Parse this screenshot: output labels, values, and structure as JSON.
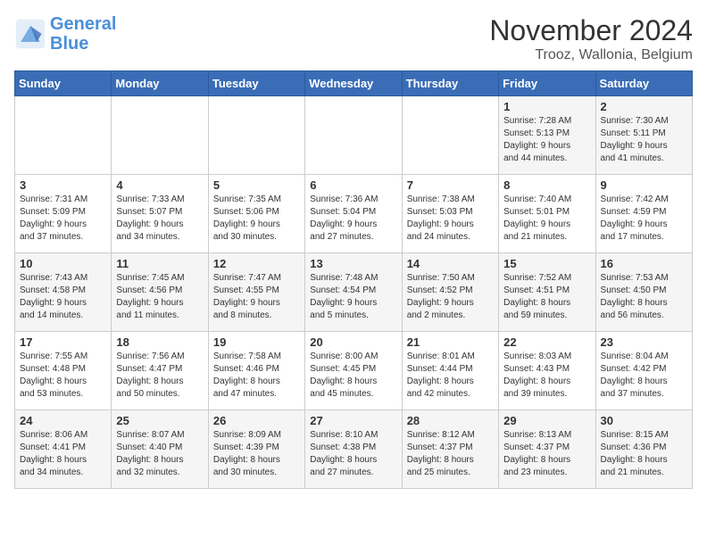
{
  "header": {
    "logo_line1": "General",
    "logo_line2": "Blue",
    "month": "November 2024",
    "location": "Trooz, Wallonia, Belgium"
  },
  "weekdays": [
    "Sunday",
    "Monday",
    "Tuesday",
    "Wednesday",
    "Thursday",
    "Friday",
    "Saturday"
  ],
  "weeks": [
    [
      {
        "day": "",
        "info": ""
      },
      {
        "day": "",
        "info": ""
      },
      {
        "day": "",
        "info": ""
      },
      {
        "day": "",
        "info": ""
      },
      {
        "day": "",
        "info": ""
      },
      {
        "day": "1",
        "info": "Sunrise: 7:28 AM\nSunset: 5:13 PM\nDaylight: 9 hours\nand 44 minutes."
      },
      {
        "day": "2",
        "info": "Sunrise: 7:30 AM\nSunset: 5:11 PM\nDaylight: 9 hours\nand 41 minutes."
      }
    ],
    [
      {
        "day": "3",
        "info": "Sunrise: 7:31 AM\nSunset: 5:09 PM\nDaylight: 9 hours\nand 37 minutes."
      },
      {
        "day": "4",
        "info": "Sunrise: 7:33 AM\nSunset: 5:07 PM\nDaylight: 9 hours\nand 34 minutes."
      },
      {
        "day": "5",
        "info": "Sunrise: 7:35 AM\nSunset: 5:06 PM\nDaylight: 9 hours\nand 30 minutes."
      },
      {
        "day": "6",
        "info": "Sunrise: 7:36 AM\nSunset: 5:04 PM\nDaylight: 9 hours\nand 27 minutes."
      },
      {
        "day": "7",
        "info": "Sunrise: 7:38 AM\nSunset: 5:03 PM\nDaylight: 9 hours\nand 24 minutes."
      },
      {
        "day": "8",
        "info": "Sunrise: 7:40 AM\nSunset: 5:01 PM\nDaylight: 9 hours\nand 21 minutes."
      },
      {
        "day": "9",
        "info": "Sunrise: 7:42 AM\nSunset: 4:59 PM\nDaylight: 9 hours\nand 17 minutes."
      }
    ],
    [
      {
        "day": "10",
        "info": "Sunrise: 7:43 AM\nSunset: 4:58 PM\nDaylight: 9 hours\nand 14 minutes."
      },
      {
        "day": "11",
        "info": "Sunrise: 7:45 AM\nSunset: 4:56 PM\nDaylight: 9 hours\nand 11 minutes."
      },
      {
        "day": "12",
        "info": "Sunrise: 7:47 AM\nSunset: 4:55 PM\nDaylight: 9 hours\nand 8 minutes."
      },
      {
        "day": "13",
        "info": "Sunrise: 7:48 AM\nSunset: 4:54 PM\nDaylight: 9 hours\nand 5 minutes."
      },
      {
        "day": "14",
        "info": "Sunrise: 7:50 AM\nSunset: 4:52 PM\nDaylight: 9 hours\nand 2 minutes."
      },
      {
        "day": "15",
        "info": "Sunrise: 7:52 AM\nSunset: 4:51 PM\nDaylight: 8 hours\nand 59 minutes."
      },
      {
        "day": "16",
        "info": "Sunrise: 7:53 AM\nSunset: 4:50 PM\nDaylight: 8 hours\nand 56 minutes."
      }
    ],
    [
      {
        "day": "17",
        "info": "Sunrise: 7:55 AM\nSunset: 4:48 PM\nDaylight: 8 hours\nand 53 minutes."
      },
      {
        "day": "18",
        "info": "Sunrise: 7:56 AM\nSunset: 4:47 PM\nDaylight: 8 hours\nand 50 minutes."
      },
      {
        "day": "19",
        "info": "Sunrise: 7:58 AM\nSunset: 4:46 PM\nDaylight: 8 hours\nand 47 minutes."
      },
      {
        "day": "20",
        "info": "Sunrise: 8:00 AM\nSunset: 4:45 PM\nDaylight: 8 hours\nand 45 minutes."
      },
      {
        "day": "21",
        "info": "Sunrise: 8:01 AM\nSunset: 4:44 PM\nDaylight: 8 hours\nand 42 minutes."
      },
      {
        "day": "22",
        "info": "Sunrise: 8:03 AM\nSunset: 4:43 PM\nDaylight: 8 hours\nand 39 minutes."
      },
      {
        "day": "23",
        "info": "Sunrise: 8:04 AM\nSunset: 4:42 PM\nDaylight: 8 hours\nand 37 minutes."
      }
    ],
    [
      {
        "day": "24",
        "info": "Sunrise: 8:06 AM\nSunset: 4:41 PM\nDaylight: 8 hours\nand 34 minutes."
      },
      {
        "day": "25",
        "info": "Sunrise: 8:07 AM\nSunset: 4:40 PM\nDaylight: 8 hours\nand 32 minutes."
      },
      {
        "day": "26",
        "info": "Sunrise: 8:09 AM\nSunset: 4:39 PM\nDaylight: 8 hours\nand 30 minutes."
      },
      {
        "day": "27",
        "info": "Sunrise: 8:10 AM\nSunset: 4:38 PM\nDaylight: 8 hours\nand 27 minutes."
      },
      {
        "day": "28",
        "info": "Sunrise: 8:12 AM\nSunset: 4:37 PM\nDaylight: 8 hours\nand 25 minutes."
      },
      {
        "day": "29",
        "info": "Sunrise: 8:13 AM\nSunset: 4:37 PM\nDaylight: 8 hours\nand 23 minutes."
      },
      {
        "day": "30",
        "info": "Sunrise: 8:15 AM\nSunset: 4:36 PM\nDaylight: 8 hours\nand 21 minutes."
      }
    ]
  ]
}
